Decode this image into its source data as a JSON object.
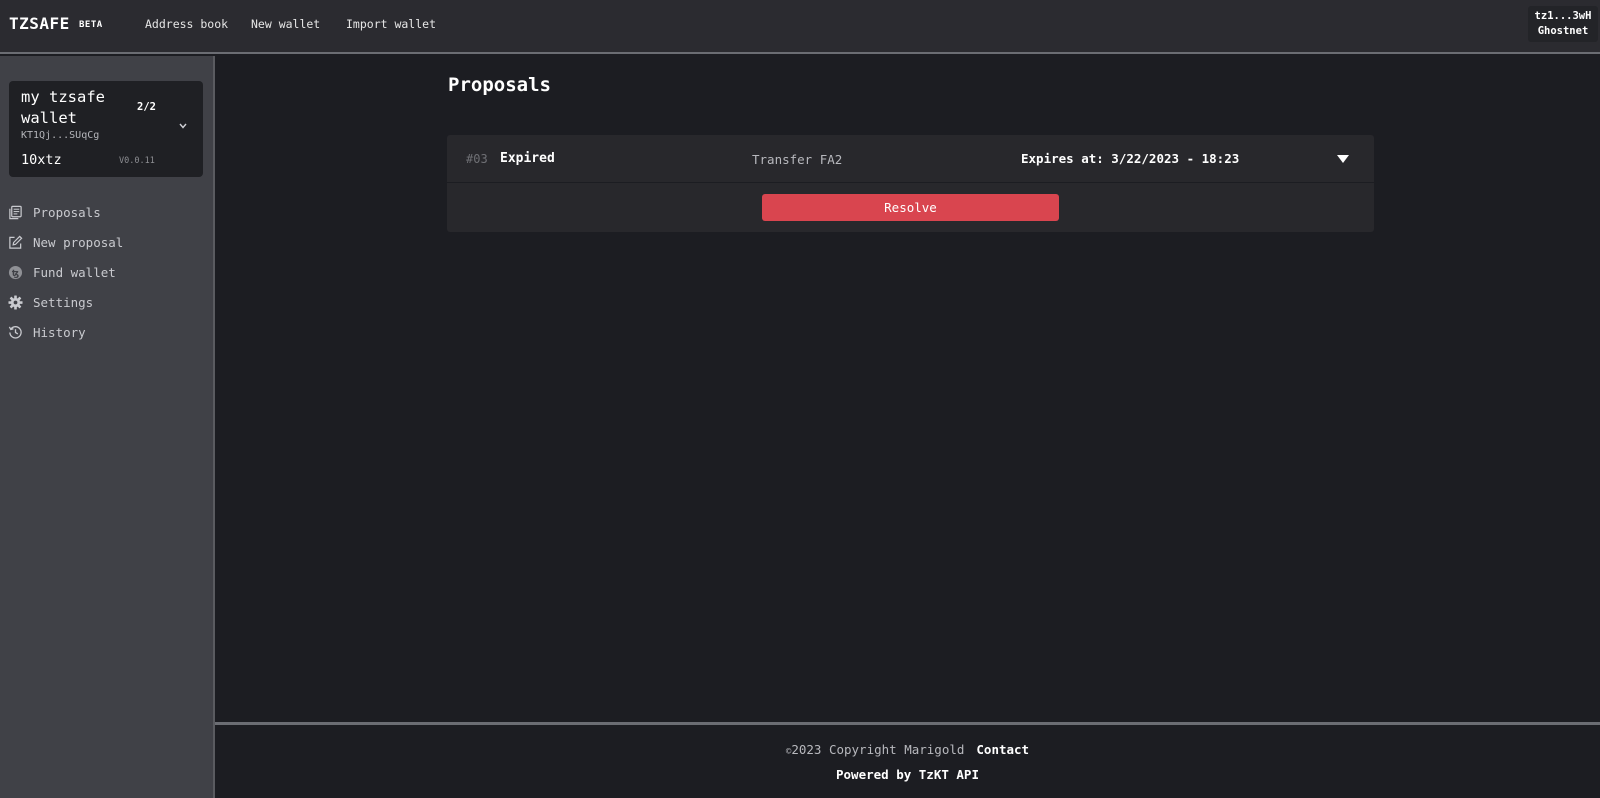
{
  "header": {
    "brand": "TZSAFE",
    "beta": "BETA",
    "nav": [
      {
        "label": "Address book"
      },
      {
        "label": "New wallet"
      },
      {
        "label": "Import wallet"
      }
    ],
    "account": {
      "address": "tz1...3wH",
      "network": "Ghostnet"
    }
  },
  "wallet": {
    "name": "my tzsafe wallet",
    "threshold": "2/2",
    "address": "KT1Qj...SUqCg",
    "balance": "10xtz",
    "version": "V0.0.11"
  },
  "sidebar": {
    "items": [
      {
        "label": "Proposals",
        "icon": "proposals-icon"
      },
      {
        "label": "New proposal",
        "icon": "edit-icon"
      },
      {
        "label": "Fund wallet",
        "icon": "tezos-coin-icon"
      },
      {
        "label": "Settings",
        "icon": "gear-icon"
      },
      {
        "label": "History",
        "icon": "history-icon"
      }
    ]
  },
  "main": {
    "title": "Proposals",
    "proposals": [
      {
        "id": "#03",
        "status": "Expired",
        "type": "Transfer FA2",
        "expires": "Expires at: 3/22/2023 - 18:23",
        "action": "Resolve"
      }
    ]
  },
  "footer": {
    "copyright_symbol": "©",
    "copyright": "2023 Copyright Marigold",
    "contact": "Contact",
    "powered": "Powered by TzKT API"
  },
  "colors": {
    "background": "#1c1d22",
    "topbar": "#2b2b30",
    "sidebar": "#404147",
    "card": "#28282c",
    "danger": "#d9454f"
  }
}
